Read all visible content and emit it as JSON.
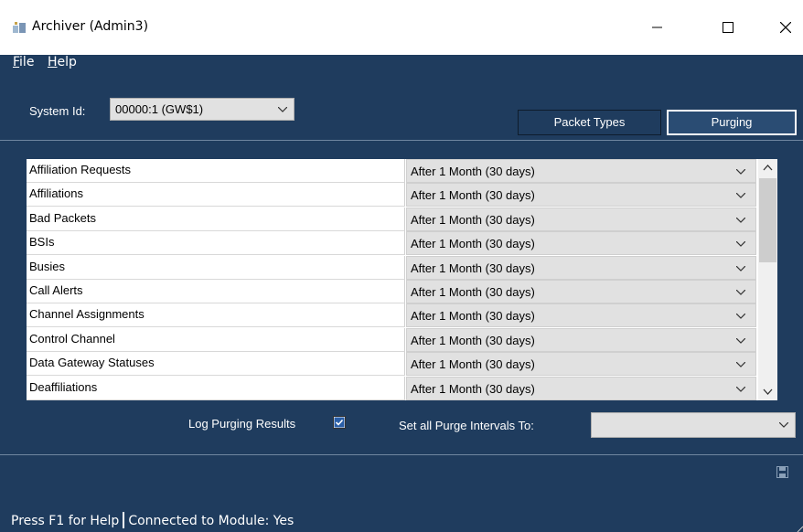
{
  "window": {
    "title": "Archiver (Admin3)",
    "icon": "archiver-app-icon",
    "controls": [
      "minimize-icon",
      "maximize-icon",
      "close-icon"
    ]
  },
  "menu": {
    "file": "File",
    "help": "Help"
  },
  "system": {
    "label": "System Id:",
    "value": "00000:1 (GW$1)"
  },
  "tabs": {
    "packet_types": "Packet Types",
    "purging": "Purging",
    "active": "Purging"
  },
  "purge_rows": [
    {
      "name": "Affiliation Requests",
      "interval": "After 1 Month (30 days)"
    },
    {
      "name": "Affiliations",
      "interval": "After 1 Month (30 days)"
    },
    {
      "name": "Bad Packets",
      "interval": "After 1 Month (30 days)"
    },
    {
      "name": "BSIs",
      "interval": "After 1 Month (30 days)"
    },
    {
      "name": "Busies",
      "interval": "After 1 Month (30 days)"
    },
    {
      "name": "Call Alerts",
      "interval": "After 1 Month (30 days)"
    },
    {
      "name": "Channel Assignments",
      "interval": "After 1 Month (30 days)"
    },
    {
      "name": "Control Channel",
      "interval": "After 1 Month (30 days)"
    },
    {
      "name": "Data Gateway Statuses",
      "interval": "After 1 Month (30 days)"
    },
    {
      "name": "Deaffiliations",
      "interval": "After 1 Month (30 days)"
    }
  ],
  "options": {
    "log_purging_label": "Log Purging Results",
    "log_purging_checked": true,
    "set_all_label": "Set all Purge Intervals To:",
    "set_all_value": ""
  },
  "status": {
    "help_hint": "Press F1 for Help",
    "connection": "Connected to Module: Yes"
  },
  "colors": {
    "background": "#1f3c5e",
    "titlebar": "#ffffff",
    "combo": "#e1e1e1",
    "active_tab_border": "#ffffff"
  }
}
